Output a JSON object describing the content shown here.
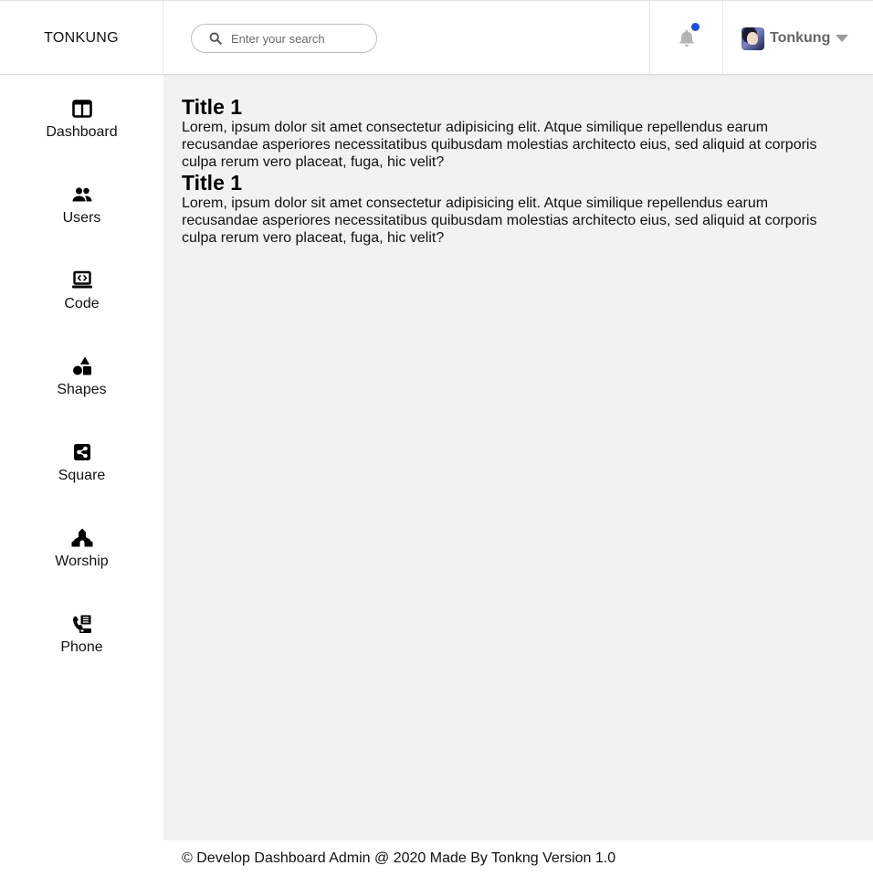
{
  "header": {
    "brand": "TONKUNG",
    "search": {
      "placeholder": "Enter your search",
      "value": ""
    },
    "notification": {
      "icon": "bell-icon",
      "dot_color": "#1f4fe0",
      "icon_color": "#b3b3b3"
    },
    "user": {
      "name": "Tonkung",
      "avatar": "avatar-image",
      "caret": "caret-down-icon"
    }
  },
  "sidebar": {
    "items": [
      {
        "label": "Dashboard",
        "icon": "columns-icon"
      },
      {
        "label": "Users",
        "icon": "users-icon"
      },
      {
        "label": "Code",
        "icon": "laptop-code-icon"
      },
      {
        "label": "Shapes",
        "icon": "shapes-icon"
      },
      {
        "label": "Square",
        "icon": "share-square-icon"
      },
      {
        "label": "Worship",
        "icon": "place-of-worship-icon"
      },
      {
        "label": "Phone",
        "icon": "phone-office-icon"
      }
    ]
  },
  "main": {
    "sections": [
      {
        "title": "Title 1",
        "body": "Lorem, ipsum dolor sit amet consectetur adipisicing elit. Atque similique repellendus earum recusandae asperiores necessitatibus quibusdam molestias architecto eius, sed aliquid at corporis culpa rerum vero placeat, fuga, hic velit?"
      },
      {
        "title": "Title 1",
        "body": "Lorem, ipsum dolor sit amet consectetur adipisicing elit. Atque similique repellendus earum recusandae asperiores necessitatibus quibusdam molestias architecto eius, sed aliquid at corporis culpa rerum vero placeat, fuga, hic velit?"
      }
    ]
  },
  "footer": {
    "text": "© Develop Dashboard Admin @ 2020 Made By Tonkng Version 1.0"
  },
  "colors": {
    "main_background": "#f1f2f1",
    "surface": "#ffffff",
    "text": "#111111",
    "username": "#666666"
  }
}
